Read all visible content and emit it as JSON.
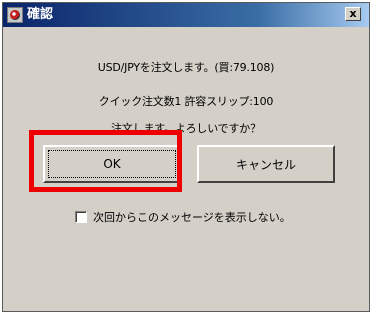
{
  "window": {
    "title": "確認",
    "close_glyph": "x"
  },
  "messages": {
    "order": "USD/JPYを注文します。(買:79.108)",
    "details": "クイック注文数1  許容スリップ:100",
    "confirm": "注文します。よろしいですか？"
  },
  "buttons": {
    "ok_label": "OK",
    "cancel_label": "キャンセル"
  },
  "checkbox": {
    "label": "次回からこのメッセージを表示しない。",
    "checked": false
  },
  "highlight": {
    "color": "#ee0000"
  }
}
